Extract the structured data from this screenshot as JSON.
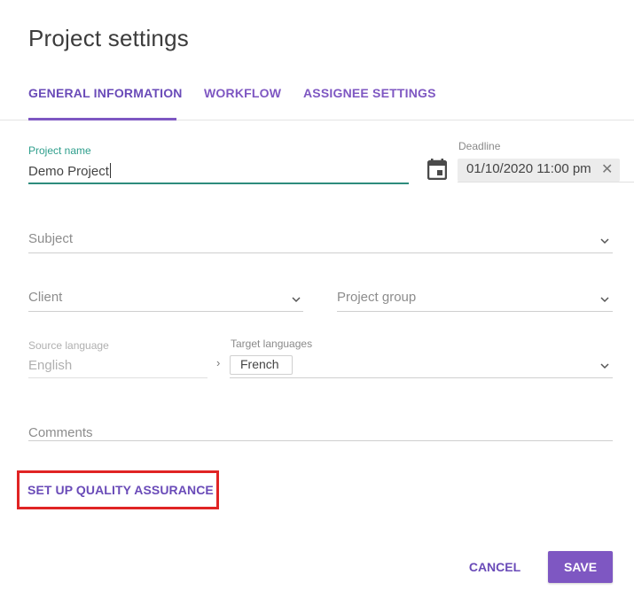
{
  "dialog": {
    "title": "Project settings"
  },
  "tabs": [
    {
      "label": "GENERAL INFORMATION",
      "active": true
    },
    {
      "label": "WORKFLOW",
      "active": false
    },
    {
      "label": "ASSIGNEE SETTINGS",
      "active": false
    }
  ],
  "form": {
    "project_name": {
      "label": "Project name",
      "value": "Demo Project"
    },
    "deadline": {
      "label": "Deadline",
      "value": "01/10/2020 11:00 pm",
      "clear_glyph": "✕"
    },
    "subject": {
      "placeholder": "Subject"
    },
    "client": {
      "placeholder": "Client"
    },
    "project_group": {
      "placeholder": "Project group"
    },
    "source_language": {
      "label": "Source language",
      "value": "English"
    },
    "target_languages": {
      "label": "Target languages",
      "values": [
        "French"
      ]
    },
    "comments": {
      "placeholder": "Comments"
    }
  },
  "links": {
    "qa_label": "SET UP QUALITY ASSURANCE"
  },
  "actions": {
    "cancel_label": "CANCEL",
    "save_label": "SAVE"
  },
  "icons": {
    "calendar": "calendar-icon",
    "dropdown": "chevron-down-icon",
    "arrow": "chevron-right-icon",
    "clear": "close-icon"
  },
  "colors": {
    "accent": "#7e57c2",
    "focus": "#2e8c7d",
    "highlight_box": "#e02424"
  }
}
